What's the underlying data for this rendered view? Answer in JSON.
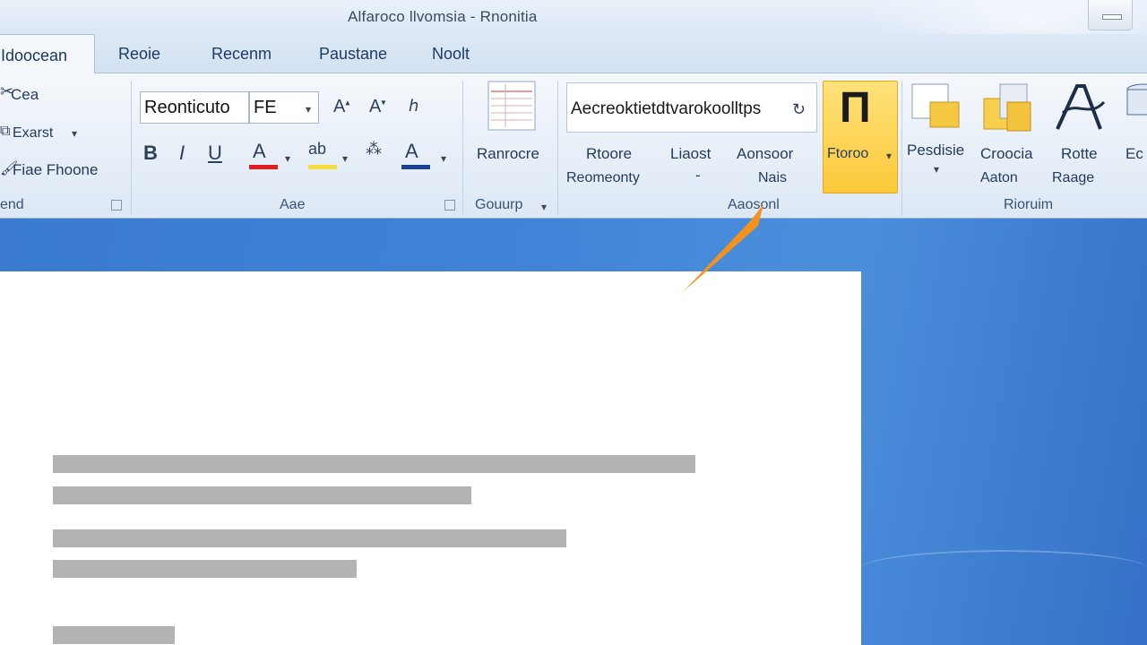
{
  "window": {
    "title": "Alfaroco llvomsia - Rnonitia",
    "minimize_label": ""
  },
  "tabs": [
    {
      "label": "Idoocean"
    },
    {
      "label": "Reoie"
    },
    {
      "label": "Recenm"
    },
    {
      "label": "Paustane"
    },
    {
      "label": "Noolt"
    }
  ],
  "clipboard": {
    "items": [
      "Cea",
      "Exarst",
      "Fiae Fhoone"
    ],
    "group_label": "end"
  },
  "font": {
    "name_value": "Reonticuto",
    "size_value": "FE",
    "group_label": "Aae",
    "bold": "B",
    "italic": "I",
    "underline": "U",
    "font_color": "A",
    "highlight": "ab",
    "text_effects": "A"
  },
  "paragraph": {
    "button_label": "Ranrocre",
    "group_label": "Gouurp"
  },
  "styles": {
    "gallery_text": "Aecreoktietdtvarokoolltps",
    "btn1_line1": "Rtoore",
    "btn1_line2": "Reomeonty",
    "btn2_line1": "Liaost",
    "btn2_line2": "-",
    "btn3_line1": "Aonsoor",
    "btn3_line2": "Nais",
    "active_btn": "Ftoroo",
    "active_icon": "Π",
    "group_label": "Aaosonl"
  },
  "editing": {
    "btn1": "Pesdisie",
    "btn2_line1": "Croocia",
    "btn2_line2": "Aaton",
    "btn3_line1": "Rotte",
    "btn3_line2": "Raage",
    "btn4": "Ec",
    "group_label": "Rioruim"
  },
  "colors": {
    "accent": "#fcc93a",
    "arrow": "#f5921e",
    "ribbon": "#dde8f5",
    "workspace": "#3f82d6"
  },
  "document": {
    "text_lines": [
      0.56,
      0.365,
      0.448,
      0.265,
      0.106
    ]
  }
}
